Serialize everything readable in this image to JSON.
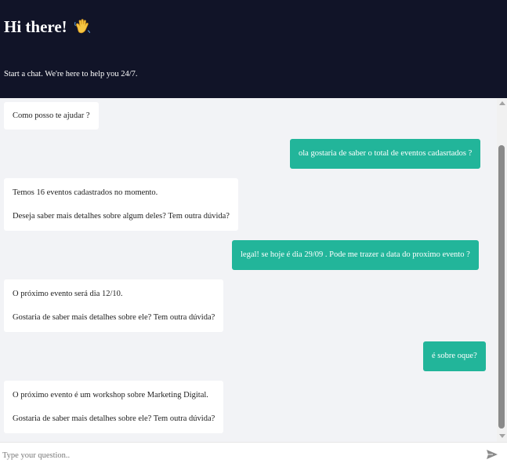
{
  "header": {
    "title": "Hi there!",
    "wave_icon": "waving-hand-icon",
    "subtitle": "Start a chat. We're here to help you 24/7."
  },
  "messages": [
    {
      "role": "bot",
      "lines": [
        "Como posso te ajudar ?"
      ]
    },
    {
      "role": "user",
      "lines": [
        "ola gostaria de saber o total de eventos cadasrtados ?"
      ]
    },
    {
      "role": "bot",
      "lines": [
        "Temos 16 eventos cadastrados no momento.",
        "Deseja saber mais detalhes sobre algum deles? Tem outra dúvida?"
      ]
    },
    {
      "role": "user",
      "lines": [
        "legal! se hoje é dia 29/09 . Pode me trazer a data do proximo evento ?"
      ]
    },
    {
      "role": "bot",
      "lines": [
        "O próximo evento será dia 12/10.",
        "Gostaria de saber mais detalhes sobre ele? Tem outra dúvida?"
      ]
    },
    {
      "role": "user",
      "lines": [
        "é sobre oque?"
      ]
    },
    {
      "role": "bot",
      "lines": [
        "O próximo evento é um workshop sobre Marketing Digital.",
        "Gostaria de saber mais detalhes sobre ele? Tem outra dúvida?"
      ]
    }
  ],
  "input": {
    "placeholder": "Type your question..",
    "value": "",
    "send_icon": "send-icon"
  },
  "colors": {
    "header_bg": "#111428",
    "user_bubble": "#22b59a",
    "bot_bubble": "#ffffff",
    "chat_bg": "#f2f3f6"
  }
}
